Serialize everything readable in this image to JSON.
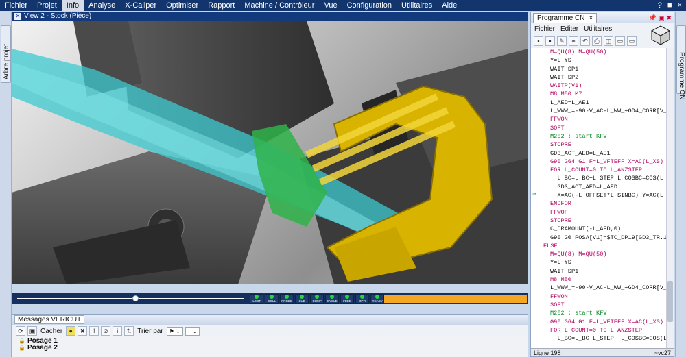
{
  "menu": [
    "Fichier",
    "Projet",
    "Info",
    "Analyse",
    "X-Caliper",
    "Optimiser",
    "Rapport",
    "Machine / Contrôleur",
    "Vue",
    "Configuration",
    "Utilitaires",
    "Aide"
  ],
  "menu_active": "Info",
  "menu_right": [
    "?",
    "■",
    "×"
  ],
  "left_tab": "Arbre projet",
  "view_title": "View 2 - Stock (Pièce)",
  "status_leds": [
    "LIMIT",
    "COLL",
    "PROBE",
    "SUB",
    "COMP",
    "CYCLE",
    "FEED",
    "OPTI",
    "READY"
  ],
  "slider_position": 0.52,
  "messages": {
    "title": "Messages VERICUT",
    "hide_label": "Cacher",
    "sort_label": "Trier par",
    "items": [
      "Posage 1",
      "Posage 2"
    ]
  },
  "cnc": {
    "tab": "Programme CN",
    "menu": [
      "Fichier",
      "Editer",
      "Utilitaires"
    ],
    "status_line": "Ligne 198",
    "status_right": "~vc27",
    "lines": [
      {
        "t": "M=QU(8) M=QU(50)",
        "c": "kw"
      },
      {
        "t": "Y=L_YS",
        "c": "bk"
      },
      {
        "t": "WAIT_SP1",
        "c": "bk"
      },
      {
        "t": "WAIT_SP2",
        "c": "bk"
      },
      {
        "t": "WAITP(V1)",
        "c": "kw"
      },
      {
        "t": "M8 M50 M7",
        "c": "kw"
      },
      {
        "t": "L_AED=L_AE1",
        "c": "bk"
      },
      {
        "t": "L_WWW_=-90-V_AC-L_WW_+GD4_CORR[V_",
        "c": "bk"
      },
      {
        "t": "FFWON",
        "c": "kw"
      },
      {
        "t": "SOFT",
        "c": "kw"
      },
      {
        "t": "M202 ; start KFV",
        "c": "cm"
      },
      {
        "t": "STOPRE",
        "c": "kw"
      },
      {
        "t": "GD3_ACT_AED=L_AE1",
        "c": "bk"
      },
      {
        "t": "G90 G64 G1 F=L_VFTEFF X=AC(L_XS)",
        "c": "kw"
      },
      {
        "t": "FOR L_COUNT=0 TO L_ANZSTEP",
        "c": "kw"
      },
      {
        "t": "  L_BC=L_BC+L_STEP L_COSBC=COS(L_",
        "c": "bk"
      },
      {
        "t": "  GD3_ACT_AED=L_AED",
        "c": "bk"
      },
      {
        "t": "  X=AC(-L_OFFSET*L_SINBC) Y=AC(L_",
        "c": "bk",
        "arrow": true
      },
      {
        "t": "ENDFOR",
        "c": "kw"
      },
      {
        "t": "FFWOF",
        "c": "kw"
      },
      {
        "t": "STOPRE",
        "c": "kw"
      },
      {
        "t": "C_DRAMOUNT(-L_AED,0)",
        "c": "bk"
      },
      {
        "t": "G90 G0 POSA[V1]=$TC_DP19[GD3_TR.1",
        "c": "bk"
      },
      {
        "t": "ELSE",
        "c": "kw",
        "indent": -1
      },
      {
        "t": "M=QU(8) M=QU(50)",
        "c": "kw"
      },
      {
        "t": "Y=L_YS",
        "c": "bk"
      },
      {
        "t": "WAIT_SP1",
        "c": "bk"
      },
      {
        "t": "M8 M50",
        "c": "kw"
      },
      {
        "t": "L_WWW_=-90-V_AC-L_WW_+GD4_CORR[V_",
        "c": "bk"
      },
      {
        "t": "FFWON",
        "c": "kw"
      },
      {
        "t": "SOFT",
        "c": "kw"
      },
      {
        "t": "M202 ; start KFV",
        "c": "cm"
      },
      {
        "t": "G90 G64 G1 F=L_VFTEFF X=AC(L_XS)",
        "c": "kw"
      },
      {
        "t": "FOR L_COUNT=0 TO L_ANZSTEP",
        "c": "kw"
      },
      {
        "t": "  L_BC=L_BC+L_STEP  L_COSBC=COS(L_",
        "c": "bk"
      }
    ]
  },
  "right_tab": "Programme CN",
  "colors": {
    "menubar": "#12356e",
    "progress": "#f5a623",
    "led_on": "#2bd443",
    "tool_cyan": "#3ec9cf",
    "part_yellow": "#d8b400"
  }
}
